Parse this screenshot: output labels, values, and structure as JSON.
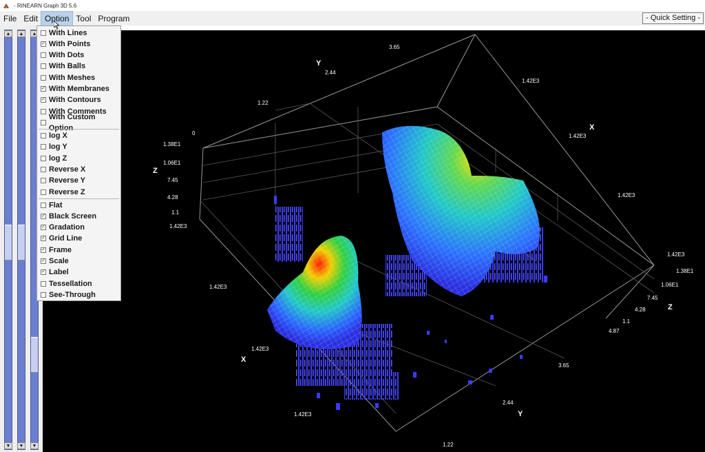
{
  "window": {
    "title": "- RINEARN Graph 3D 5.6"
  },
  "menubar": {
    "items": [
      "File",
      "Edit",
      "Option",
      "Tool",
      "Program"
    ],
    "active": "Option",
    "quick_setting": "- Quick Setting -"
  },
  "option_menu": {
    "group1": [
      {
        "label": "With Lines",
        "checked": false
      },
      {
        "label": "With Points",
        "checked": true
      },
      {
        "label": "With Dots",
        "checked": false
      },
      {
        "label": "With Balls",
        "checked": false
      },
      {
        "label": "With Meshes",
        "checked": false
      },
      {
        "label": "With Membranes",
        "checked": true
      },
      {
        "label": "With Contours",
        "checked": true
      },
      {
        "label": "With Comments",
        "checked": false
      },
      {
        "label": "With Custom Option",
        "checked": false
      }
    ],
    "group2": [
      {
        "label": "log X",
        "checked": false
      },
      {
        "label": "log Y",
        "checked": false
      },
      {
        "label": "log Z",
        "checked": false
      },
      {
        "label": "Reverse X",
        "checked": false
      },
      {
        "label": "Reverse Y",
        "checked": false
      },
      {
        "label": "Reverse Z",
        "checked": false
      }
    ],
    "group3": [
      {
        "label": "Flat",
        "checked": false
      },
      {
        "label": "Black Screen",
        "checked": true
      },
      {
        "label": "Gradation",
        "checked": true
      },
      {
        "label": "Grid Line",
        "checked": true
      },
      {
        "label": "Frame",
        "checked": true
      },
      {
        "label": "Scale",
        "checked": true
      },
      {
        "label": "Label",
        "checked": true
      },
      {
        "label": "Tessellation",
        "checked": false
      },
      {
        "label": "See-Through",
        "checked": false
      }
    ]
  },
  "plot": {
    "axis_names": {
      "x": "X",
      "y": "Y",
      "z": "Z"
    },
    "tick_labels": {
      "top_y": [
        "0",
        "1.22",
        "2.44",
        "3.65"
      ],
      "top_x": [
        "1.42E3",
        "1.42E3",
        "1.42E3"
      ],
      "left_z": [
        "1.38E1",
        "1.06E1",
        "7.45",
        "4.28",
        "1.1",
        "1.42E3"
      ],
      "right_z": [
        "1.42E3",
        "1.38E1",
        "1.06E1",
        "7.45",
        "4.28",
        "1.1",
        "4.87"
      ],
      "bottom_y": [
        "3.65",
        "2.44",
        "1.22"
      ],
      "bottom_x": [
        "1.42E3",
        "1.42E3",
        "1.42E3"
      ]
    },
    "colors": {
      "background": "#000000",
      "surface_low": "#3a3aff",
      "surface_mid": "#20d0c0",
      "surface_high": "#ff2000",
      "frame": "#9a9a9a"
    }
  }
}
